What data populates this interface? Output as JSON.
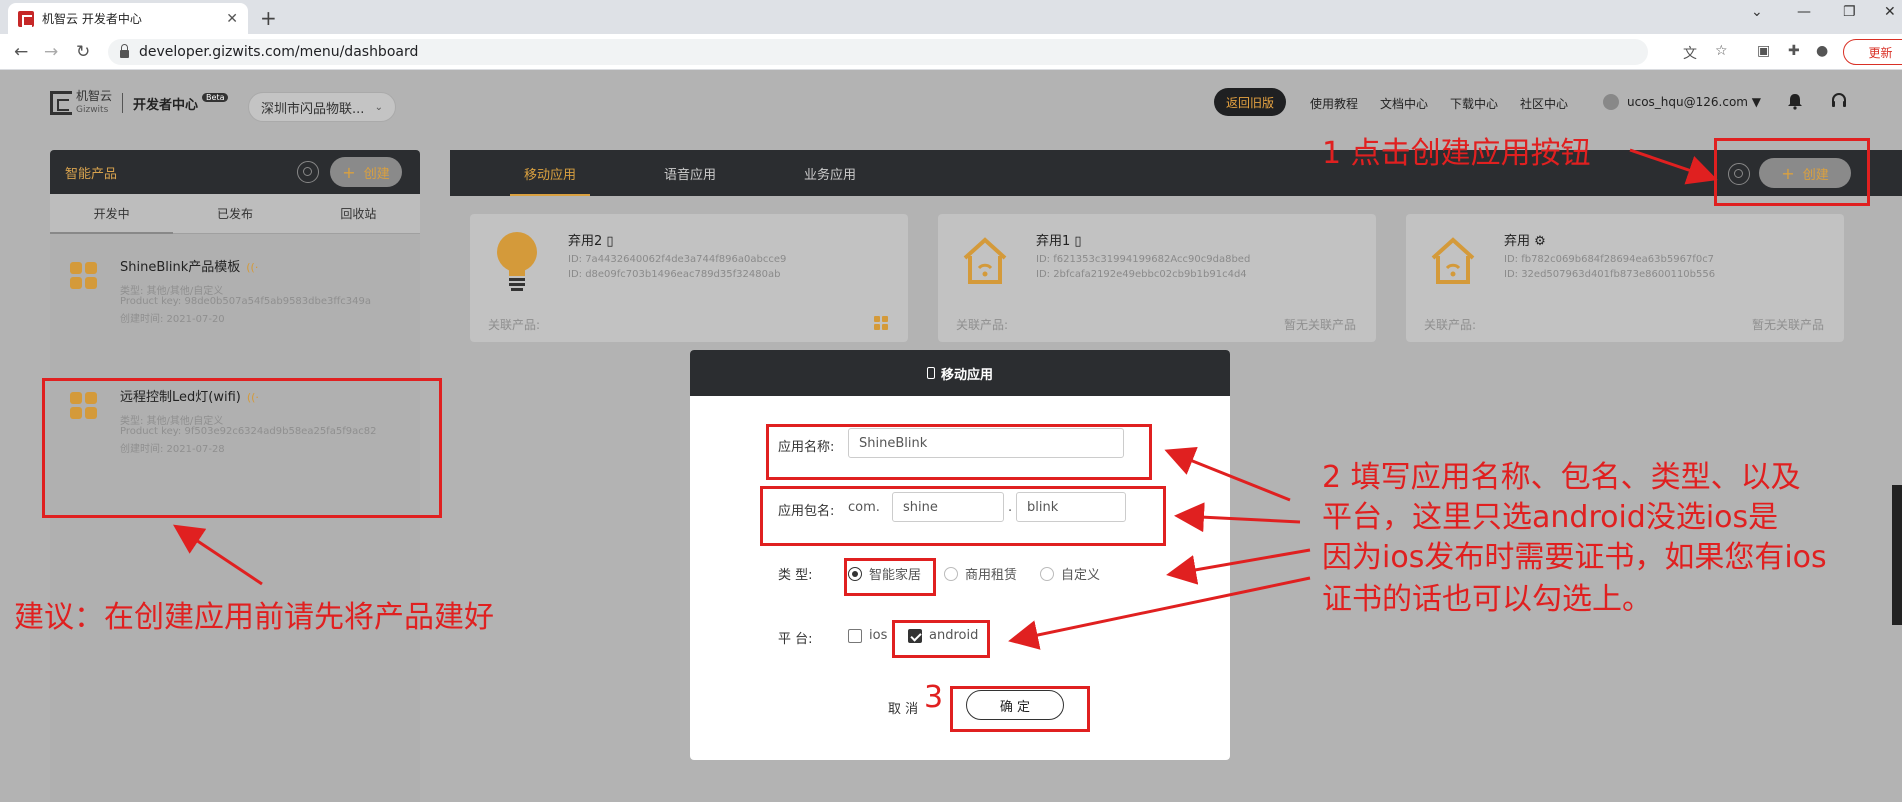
{
  "browser": {
    "tab_title": "机智云 开发者中心",
    "url": "developer.gizwits.com/menu/dashboard",
    "update_label": "更新"
  },
  "header": {
    "logo_text": "机智云",
    "logo_sub": "Gizwits",
    "dev_center": "开发者中心",
    "beta": "Beta",
    "org": "深圳市闪品物联...",
    "back_old": "返回旧版",
    "links": [
      "使用教程",
      "文档中心",
      "下载中心",
      "社区中心"
    ],
    "user": "ucos_hqu@126.com ▼"
  },
  "left_panel": {
    "title": "智能产品",
    "create_label": "创建",
    "tabs": [
      "开发中",
      "已发布",
      "回收站"
    ],
    "products": [
      {
        "name": "ShineBlink产品模板",
        "category": "类型: 其他/其他/自定义",
        "product_key": "Product key: 98de0b507a54f5ab9583dbe3ffc349a",
        "created": "创建时间: 2021-07-20"
      },
      {
        "name": "远程控制Led灯(wifi)",
        "category": "类型: 其他/其他/自定义",
        "product_key": "Product key: 9f503e92c6324ad9b58ea25fa5f9ac82",
        "created": "创建时间: 2021-07-28"
      }
    ]
  },
  "main_panel": {
    "tabs": [
      "移动应用",
      "语音应用",
      "业务应用"
    ],
    "create_label": "创建",
    "cards": [
      {
        "name": "弃用2",
        "id1": "ID:  7a4432640062f4de3a744f896a0abcce9",
        "id2": "ID:  d8e09fc703b1496eac789d35f32480ab",
        "related": "关联产品:",
        "none": ""
      },
      {
        "name": "弃用1",
        "id1": "ID:  f621353c31994199682Acc90c9da8bed",
        "id2": "ID:  2bfcafa2192e49ebbc02cb9b1b91c4d4",
        "related": "关联产品:",
        "none": "暂无关联产品"
      },
      {
        "name": "弃用",
        "id1": "ID:  fb782c069b684f28694ea63b5967f0c7",
        "id2": "ID:  32ed507963d401fb873e8600110b556",
        "related": "关联产品:",
        "none": "暂无关联产品"
      }
    ]
  },
  "modal": {
    "title": "移动应用",
    "app_name_label": "应用名称:",
    "app_name_value": "ShineBlink",
    "package_label": "应用包名:",
    "package_prefix": "com.",
    "package_part1": "shine",
    "package_dot": ".",
    "package_part2": "blink",
    "type_label": "类    型:",
    "types": [
      "智能家居",
      "商用租赁",
      "自定义"
    ],
    "platform_label": "平    台:",
    "platforms": [
      "ios",
      "android"
    ],
    "cancel": "取 消",
    "confirm": "确 定"
  },
  "annotations": {
    "step1": "1 点击创建应用按钮",
    "step2_line1": "2 填写应用名称、包名、类型、以及",
    "step2_line2": "平台，这里只选android没选ios是",
    "step2_line3": "因为ios发布时需要证书，如果您有ios",
    "step2_line4": "证书的话也可以勾选上。",
    "step3": "3",
    "advice": "建议：在创建应用前请先将产品建好",
    "color": "#e02020"
  }
}
